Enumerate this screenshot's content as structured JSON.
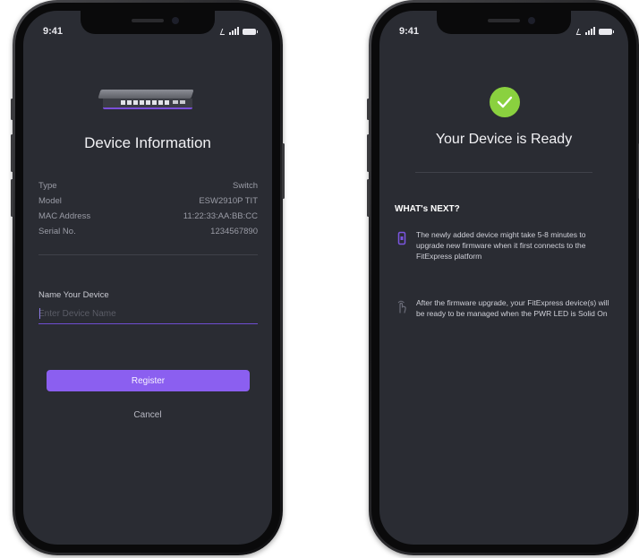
{
  "status_bar": {
    "time": "9:41"
  },
  "device_info_screen": {
    "title": "Device Information",
    "rows": [
      {
        "label": "Type",
        "value": "Switch"
      },
      {
        "label": "Model",
        "value": "ESW2910P TIT"
      },
      {
        "label": "MAC Address",
        "value": "11:22:33:AA:BB:CC"
      },
      {
        "label": "Serial No.",
        "value": "1234567890"
      }
    ],
    "name_field": {
      "label": "Name Your Device",
      "placeholder": "Enter Device Name",
      "value": ""
    },
    "register_label": "Register",
    "cancel_label": "Cancel",
    "image_icon": "network-switch-image"
  },
  "ready_screen": {
    "title": "Your Device is Ready",
    "check_icon": "checkmark-icon",
    "next_heading": "WHAT's NEXT?",
    "next_items": [
      {
        "icon": "phone-icon",
        "text": "The newly added device might take 5-8 minutes to upgrade new firmware when it first connects to the FitExpress platform"
      },
      {
        "icon": "touch-icon",
        "text": "After the firmware upgrade, your FitExpress device(s) will be ready to be managed when the PWR LED is Solid On"
      }
    ]
  },
  "colors": {
    "accent": "#8b5ff0",
    "success": "#8ad13f",
    "screen_bg": "#2a2c33"
  }
}
